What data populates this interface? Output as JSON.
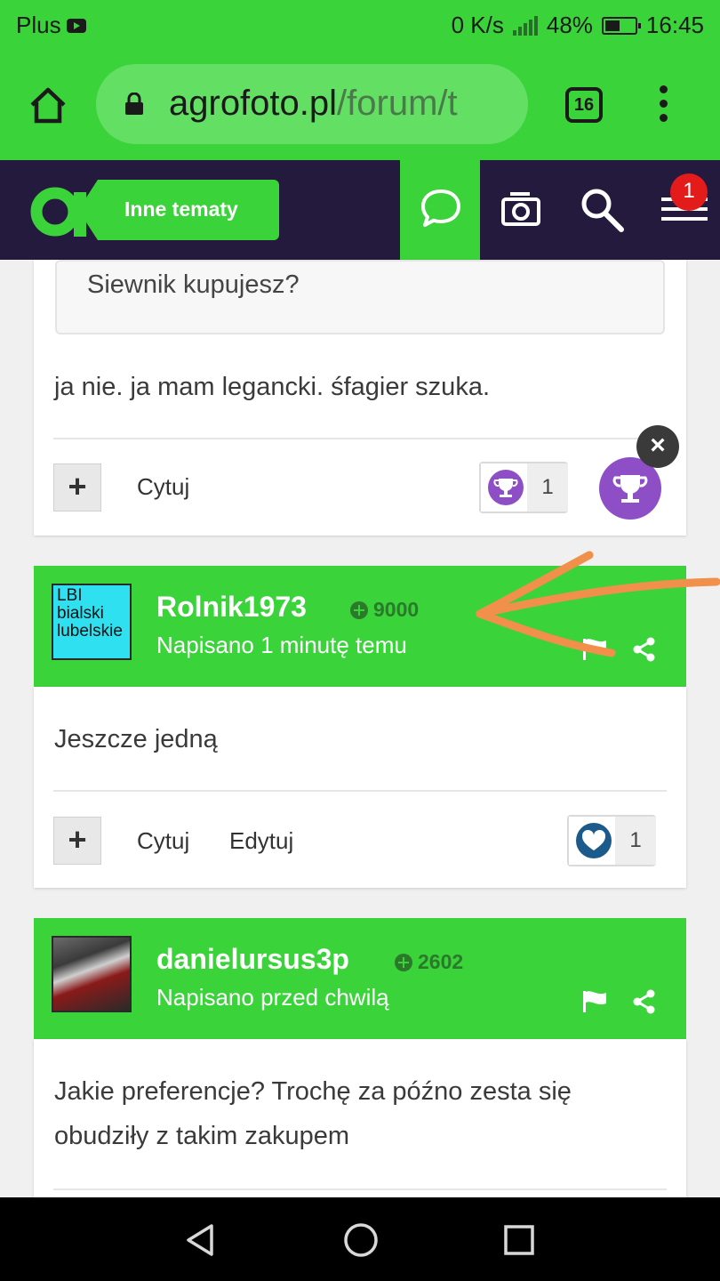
{
  "status_bar": {
    "carrier": "Plus",
    "network_speed": "0 K/s",
    "battery": "48%",
    "time": "16:45"
  },
  "browser": {
    "url_domain": "agrofoto.pl",
    "url_path": "/forum/t",
    "tab_count": "16"
  },
  "site_header": {
    "section_label": "Inne tematy",
    "notification_count": "1",
    "colors": {
      "brand_green": "#3ad33a",
      "header_dark": "#231a3d"
    }
  },
  "posts": [
    {
      "quote_text": "Siewnik kupujesz?",
      "body": "ja nie. ja mam legancki. śfagier szuka.",
      "actions": {
        "quote": "Cytuj"
      },
      "reaction": {
        "icon": "trophy-icon",
        "count": "1"
      }
    },
    {
      "username": "Rolnik1973",
      "reputation": "9000",
      "avatar_text": [
        "LBI",
        "bialski",
        "lubelskie"
      ],
      "posted": "Napisano 1 minutę temu",
      "body": "Jeszcze jedną",
      "actions": {
        "quote": "Cytuj",
        "edit": "Edytuj"
      },
      "reaction": {
        "icon": "heart-icon",
        "count": "1"
      }
    },
    {
      "username": "danielursus3p",
      "reputation": "2602",
      "posted": "Napisano przed chwilą",
      "body_lines": [
        "Jakie preferencje? Trochę za późno zesta się",
        "obudziły z takim zakupem"
      ]
    }
  ],
  "overlay": {
    "close_symbol": "×"
  }
}
